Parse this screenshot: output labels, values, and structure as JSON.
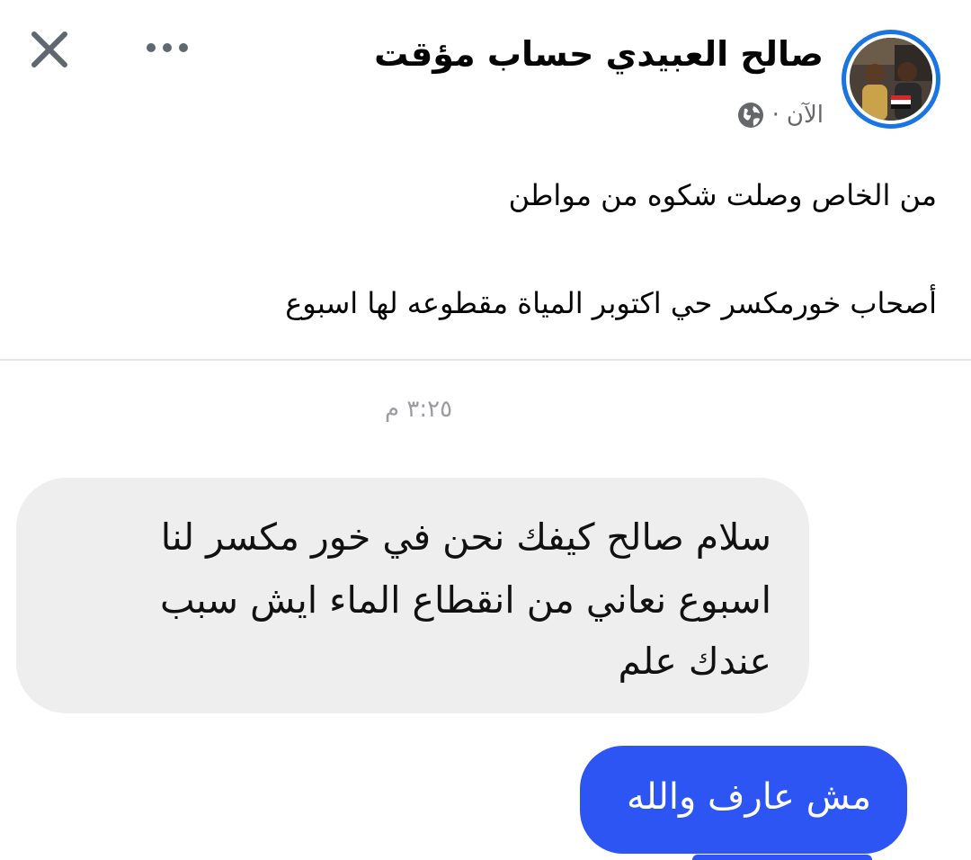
{
  "header": {
    "close_icon": "close-icon",
    "more_icon": "more-horizontal-icon",
    "author": "صالح العبيدي حساب مؤقت",
    "time": "الآن",
    "separator": "·",
    "audience_icon": "globe-icon"
  },
  "post": {
    "lines": [
      "من الخاص وصلت شكوه من مواطن",
      "أصحاب خورمكسر حي اكتوبر المياة مقطوعه لها اسبوع"
    ]
  },
  "chat": {
    "timestamp": "٣:٢٥ م",
    "incoming": {
      "lines": [
        "سلام صالح كيفك نحن في خور مكسر لنا",
        "اسبوع نعاني من انقطاع الماء ايش سبب",
        "عندك علم"
      ]
    },
    "outgoing": {
      "text": "مش عارف والله"
    }
  },
  "colors": {
    "avatar_ring": "#1b74e4",
    "incoming_bubble": "#eeeeee",
    "outgoing_bubble": "#2c55f4"
  }
}
